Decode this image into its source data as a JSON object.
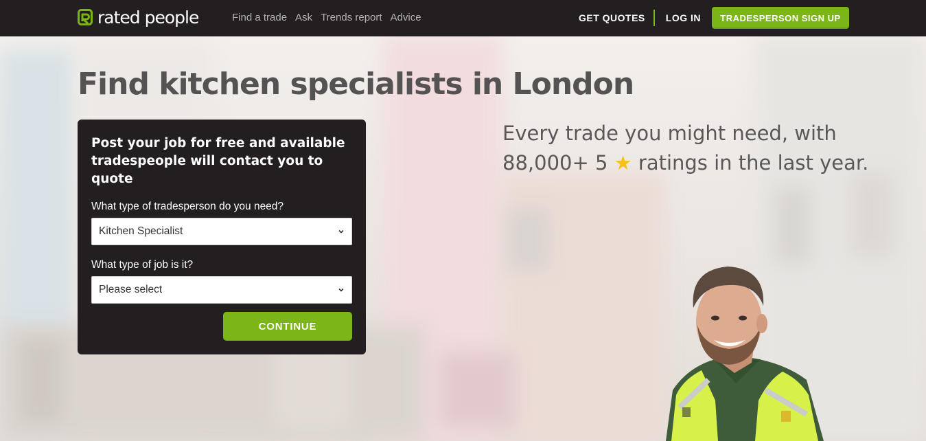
{
  "brand": {
    "name": "rated people",
    "accent": "#7cb518",
    "dark": "#231f20"
  },
  "nav": {
    "links": [
      "Find a trade",
      "Ask",
      "Trends report",
      "Advice"
    ],
    "get_quotes": "GET QUOTES",
    "log_in": "LOG IN",
    "signup": "TRADESPERSON SIGN UP"
  },
  "hero": {
    "headline": "Find kitchen specialists in London",
    "tagline_part1": "Every trade you might need, with 88,000+ 5",
    "tagline_star": "★",
    "tagline_part2": "ratings in the last year."
  },
  "form": {
    "title": "Post your job for free and available tradespeople will contact you to quote",
    "trade_label": "What type of tradesperson do you need?",
    "trade_value": "Kitchen Specialist",
    "job_label": "What type of job is it?",
    "job_value": "Please select",
    "continue": "CONTINUE"
  },
  "icons": {
    "logo": "rated-people-logo-icon",
    "select_arrow": "chevron-down-icon",
    "star": "star-icon"
  }
}
